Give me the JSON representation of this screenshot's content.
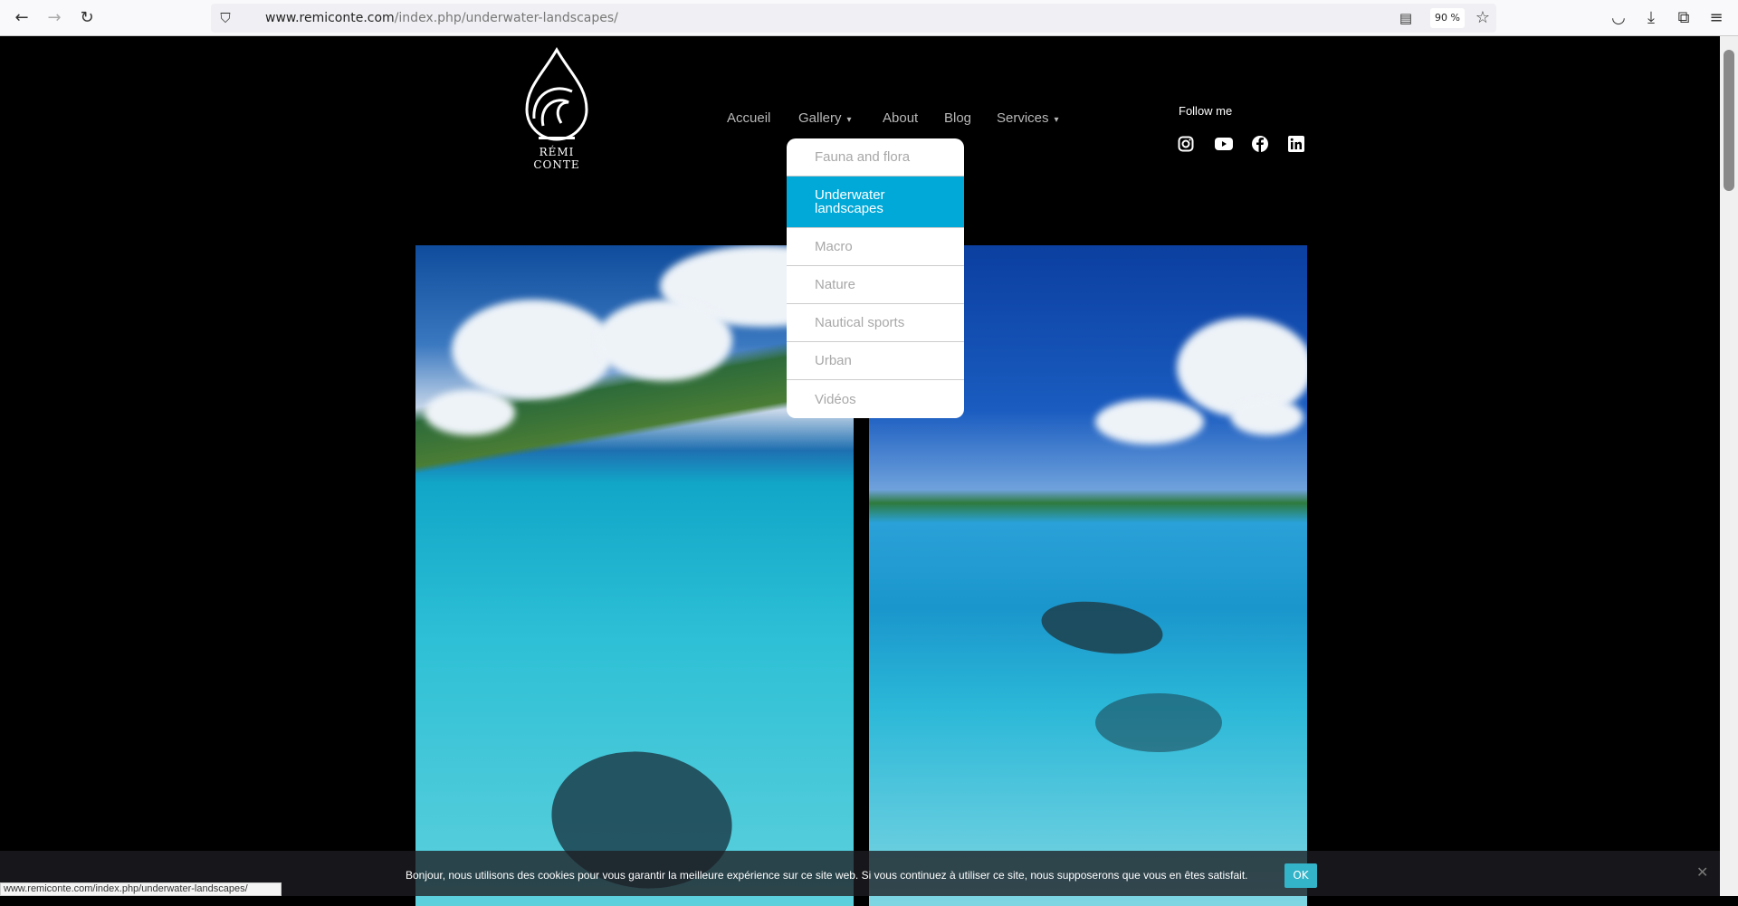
{
  "browser": {
    "url_host": "www.remiconte.com",
    "url_path": "/index.php/underwater-landscapes/",
    "zoom": "90 %"
  },
  "site": {
    "logo_text": "RÉMI CONTE",
    "nav": [
      {
        "label": "Accueil"
      },
      {
        "label": "Gallery",
        "caret": "▾"
      },
      {
        "label": "About"
      },
      {
        "label": "Blog"
      },
      {
        "label": "Services",
        "caret": "▾"
      }
    ],
    "follow_label": "Follow me",
    "social": [
      "instagram-icon",
      "youtube-icon",
      "facebook-icon",
      "linkedin-icon"
    ],
    "gallery_menu": [
      "Fauna and flora",
      "Underwater landscapes",
      "Macro",
      "Nature",
      "Nautical sports",
      "Urban",
      "Vidéos"
    ],
    "active_menu": "Underwater landscapes",
    "accent": "#00a9d8"
  },
  "cookie": {
    "text": "Bonjour, nous utilisons des cookies pour vous garantir la meilleure expérience sur ce site web. Si vous continuez à utiliser ce site, nous supposerons que vous en êtes satisfait.",
    "ok": "OK",
    "close": "✕"
  },
  "status_url": "www.remiconte.com/index.php/underwater-landscapes/"
}
